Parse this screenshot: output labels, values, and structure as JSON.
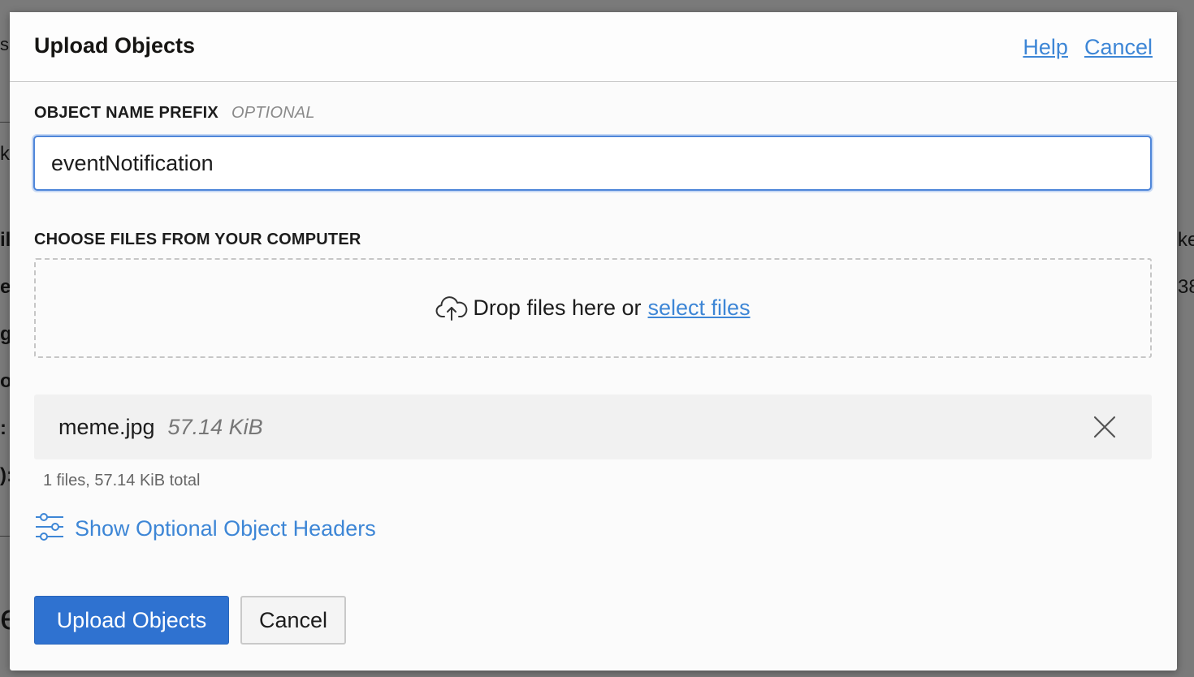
{
  "dialog": {
    "title": "Upload Objects",
    "help_link": "Help",
    "cancel_link": "Cancel"
  },
  "prefix": {
    "label": "OBJECT NAME PREFIX",
    "optional_tag": "OPTIONAL",
    "value": "eventNotification"
  },
  "files": {
    "label": "CHOOSE FILES FROM YOUR COMPUTER",
    "dropzone_text": "Drop files here or",
    "select_link": "select files",
    "items": [
      {
        "name": "meme.jpg",
        "size": "57.14 KiB"
      }
    ],
    "summary": "1 files, 57.14 KiB total"
  },
  "optional_headers": {
    "label": "Show Optional Object Headers",
    "icon": "sliders-icon"
  },
  "footer": {
    "upload_label": "Upload Objects",
    "cancel_label": "Cancel"
  },
  "colors": {
    "accent": "#3d86d6",
    "primary_button": "#2f72d0"
  }
}
